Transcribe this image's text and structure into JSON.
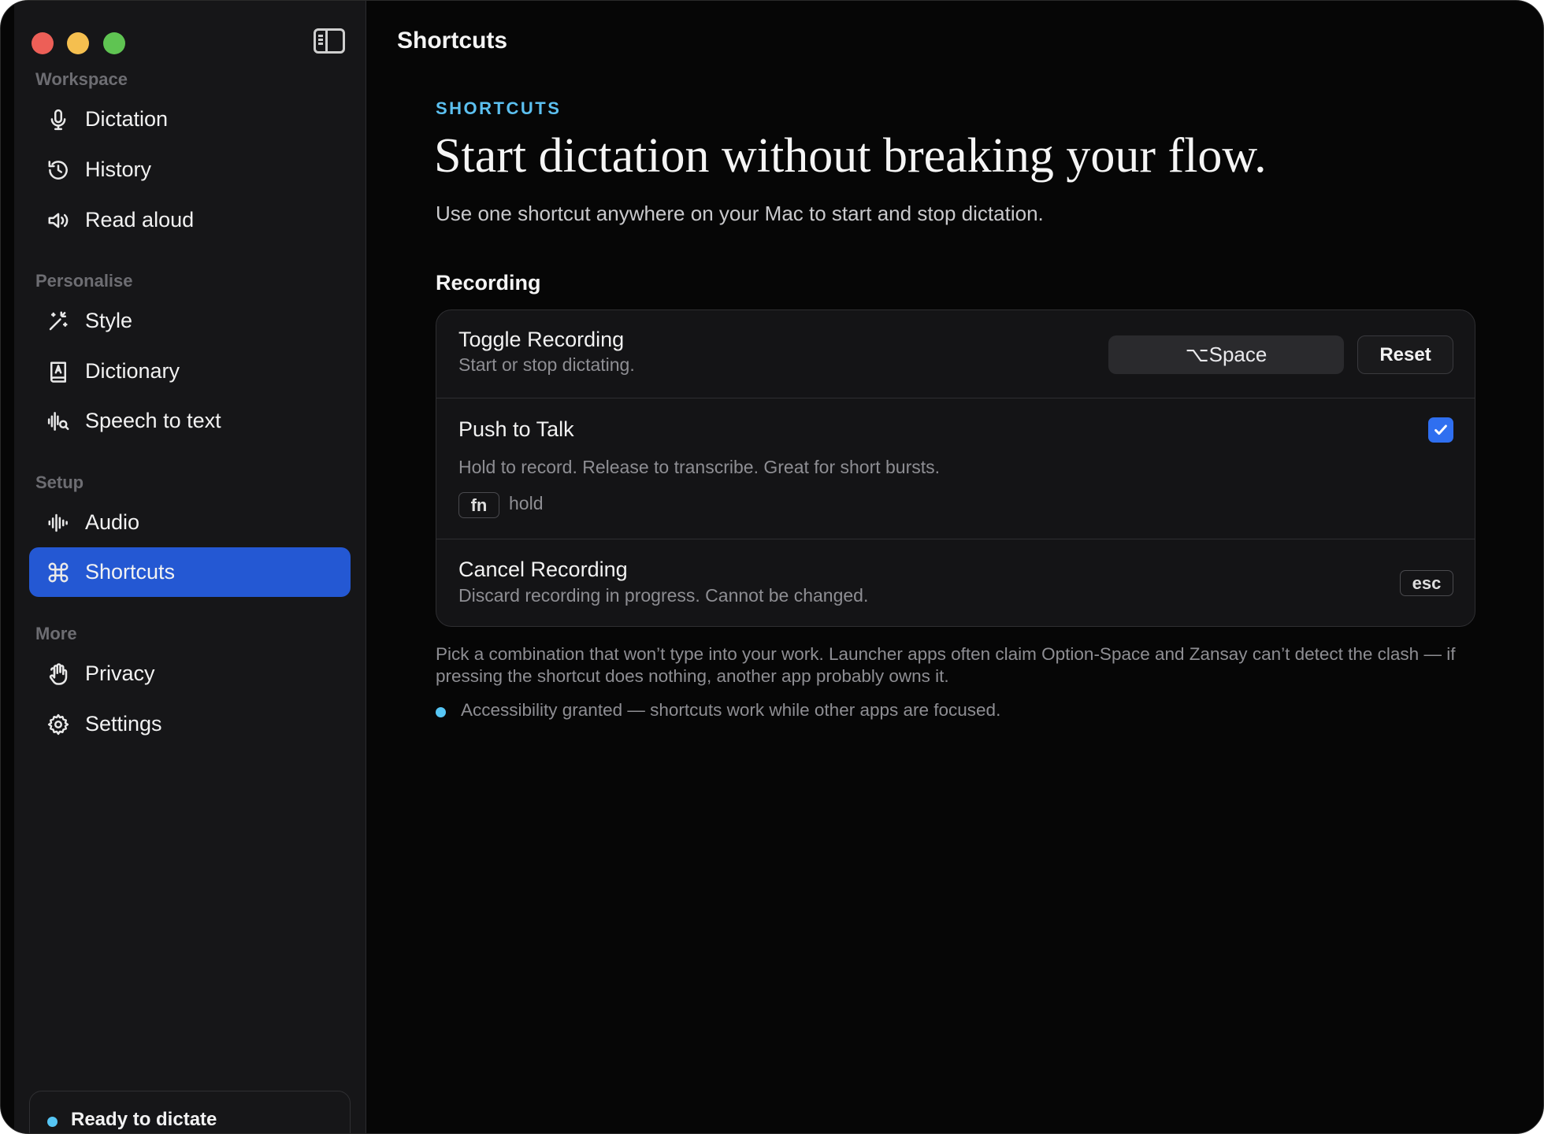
{
  "window": {
    "title": "Shortcuts"
  },
  "sidebar": {
    "sections": [
      {
        "label": "Workspace",
        "items": [
          {
            "label": "Dictation",
            "icon": "microphone-icon"
          },
          {
            "label": "History",
            "icon": "history-icon"
          },
          {
            "label": "Read aloud",
            "icon": "speaker-icon"
          }
        ]
      },
      {
        "label": "Personalise",
        "items": [
          {
            "label": "Style",
            "icon": "magic-wand-icon"
          },
          {
            "label": "Dictionary",
            "icon": "dictionary-icon"
          },
          {
            "label": "Speech to text",
            "icon": "waveform-search-icon"
          }
        ]
      },
      {
        "label": "Setup",
        "items": [
          {
            "label": "Audio",
            "icon": "waveform-icon"
          },
          {
            "label": "Shortcuts",
            "icon": "command-icon",
            "active": true
          }
        ]
      },
      {
        "label": "More",
        "items": [
          {
            "label": "Privacy",
            "icon": "hand-icon"
          },
          {
            "label": "Settings",
            "icon": "gear-icon"
          }
        ]
      }
    ],
    "status": {
      "text": "Ready to dictate",
      "dot_color": "#56c6f5"
    }
  },
  "main": {
    "eyebrow": "SHORTCUTS",
    "headline": "Start dictation without breaking your flow.",
    "subtitle": "Use one shortcut anywhere on your Mac to start and stop dictation.",
    "group_title": "Recording",
    "rows": {
      "toggle": {
        "title": "Toggle Recording",
        "description": "Start or stop dictating.",
        "shortcut": "⌥Space",
        "reset_label": "Reset"
      },
      "push": {
        "title": "Push to Talk",
        "description": "Hold to record. Release to transcribe. Great for short bursts.",
        "enabled": true,
        "key": "fn",
        "hold_label": "hold"
      },
      "cancel": {
        "title": "Cancel Recording",
        "description": "Discard recording in progress. Cannot be changed.",
        "key": "esc"
      }
    },
    "footnote": "Pick a combination that won’t type into your work. Launcher apps often claim Option-Space and Zansay can’t detect the clash — if pressing the shortcut does nothing, another app probably owns it.",
    "accessibility_note": "Accessibility granted — shortcuts work while other apps are focused."
  },
  "colors": {
    "accent": "#2458d3",
    "eyebrow": "#5cc0f0",
    "checkbox": "#2f6ff0",
    "traffic_red": "#ed5f57",
    "traffic_yellow": "#f5bf4f",
    "traffic_green": "#5fc452"
  }
}
